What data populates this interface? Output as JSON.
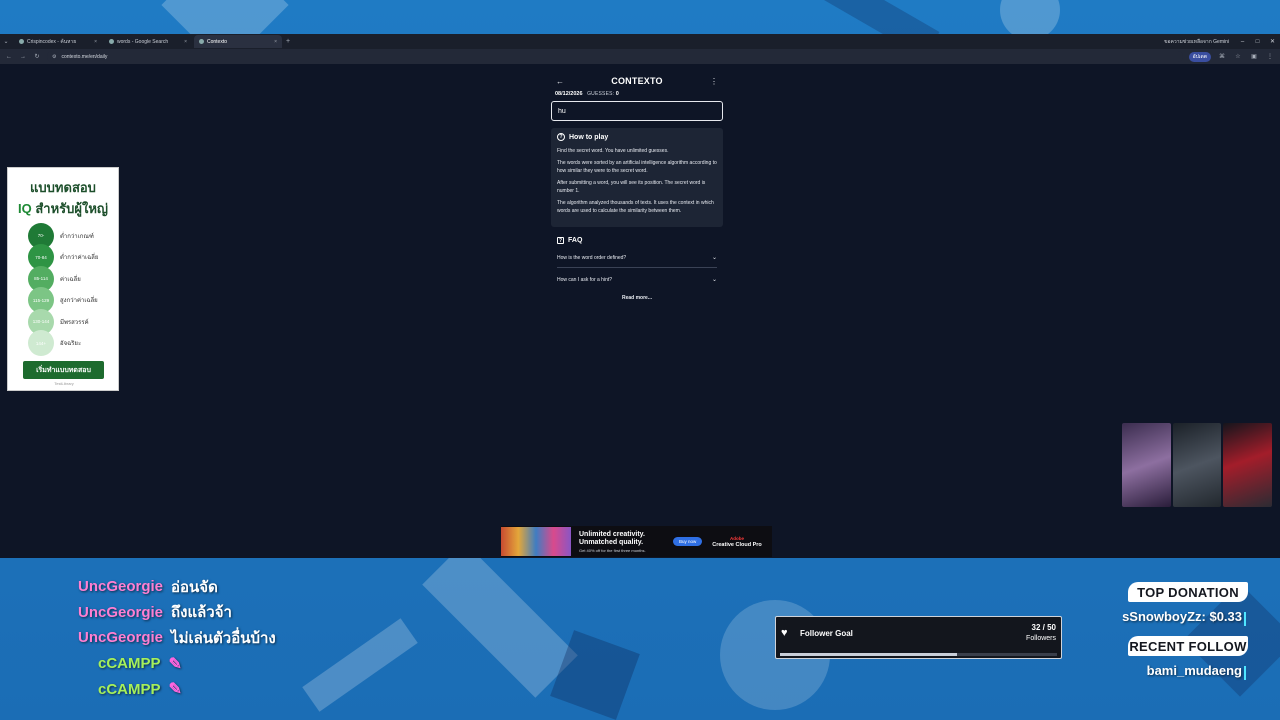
{
  "browser": {
    "tabs": [
      {
        "label": "Crispincodex - ค้นหาย",
        "active": false
      },
      {
        "label": "words - Google Search",
        "active": false
      },
      {
        "label": "Contexto",
        "active": true
      }
    ],
    "gemini_label": "ขอความช่วยเหลือจาก Gemini",
    "url": "contexto.me/en/daily",
    "profile_label": "อัปเดต"
  },
  "contexto": {
    "title": "CONTEXTO",
    "date": "08/12/2026",
    "guesses_label": "GUESSES:",
    "guesses_count": "0",
    "input_value": "hu",
    "howto": {
      "title": "How to play",
      "paragraphs": [
        "Find the secret word. You have unlimited guesses.",
        "The words were sorted by an artificial intelligence algorithm according to how similar they were to the secret word.",
        "After submitting a word, you will see its position. The secret word is number 1.",
        "The algorithm analyzed thousands of texts. It uses the context in which words are used to calculate the similarity between them."
      ]
    },
    "faq": {
      "title": "FAQ",
      "items": [
        "How is the word order defined?",
        "How can I ask for a hint?"
      ],
      "read_more": "Read more..."
    }
  },
  "ad_left": {
    "line1": "แบบทดสอบ",
    "line2_iq": "IQ",
    "line2_rest": "สำหรับผู้ใหญ่",
    "rows": [
      {
        "range": "70-",
        "label": "ต่ำกว่าเกณฑ์",
        "color": "#1f7a36"
      },
      {
        "range": "70-84",
        "label": "ต่ำกว่าค่าเฉลี่ย",
        "color": "#2e9444"
      },
      {
        "range": "85-114",
        "label": "ค่าเฉลี่ย",
        "color": "#53ad61"
      },
      {
        "range": "115-129",
        "label": "สูงกว่าค่าเฉลี่ย",
        "color": "#7cc585"
      },
      {
        "range": "130-144",
        "label": "มีพรสวรรค์",
        "color": "#a8d9ac"
      },
      {
        "range": "144+",
        "label": "อัจฉริยะ",
        "color": "#cfead1"
      }
    ],
    "cta": "เริ่มทำแบบทดสอบ",
    "source": "TestLibrary"
  },
  "ad_bottom": {
    "headline1": "Unlimited creativity.",
    "headline2": "Unmatched quality.",
    "sub": "Get 40% off for the first three months.",
    "button": "Buy now",
    "brand_top": "Adobe",
    "brand": "Creative Cloud Pro"
  },
  "chat": [
    {
      "user": "UncGeorgie",
      "message": "อ่อนจัด",
      "color": "#ff7fd2"
    },
    {
      "user": "UncGeorgie",
      "message": "ถึงแล้วจ้า",
      "color": "#ff7fd2"
    },
    {
      "user": "UncGeorgie",
      "message": "ไม่เล่นตัวอื่นบ้าง",
      "color": "#ff7fd2"
    },
    {
      "user": "cCAMPP",
      "message": "",
      "color": "#a6f05a"
    },
    {
      "user": "cCAMPP",
      "message": "",
      "color": "#a6f05a"
    }
  ],
  "follower_goal": {
    "label": "Follower Goal",
    "current": "32",
    "target": "50",
    "count_text": "32 / 50",
    "unit": "Followers",
    "progress_fraction": 0.64
  },
  "stream_labels": {
    "top_donation_title": "TOP DONATION",
    "top_donation_value": "sSnowboyZz: $0.33",
    "recent_follow_title": "RECENT FOLLOW",
    "recent_follow_value": "bami_mudaeng"
  }
}
